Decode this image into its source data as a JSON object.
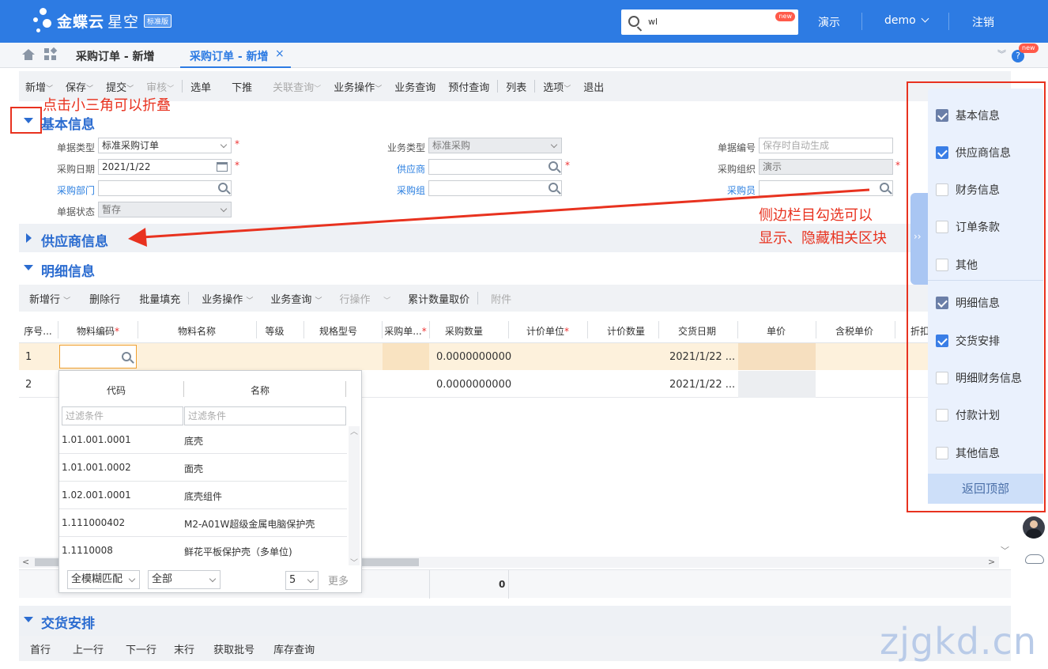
{
  "app": {
    "brand": "金蝶云",
    "brand2": "星空",
    "edition": "标准版"
  },
  "header": {
    "search_value": "wl",
    "search_badge": "new",
    "nav": [
      "演示",
      "demo",
      "注销"
    ]
  },
  "tabs": {
    "items": [
      "采购订单 - 新增",
      "采购订单 - 新增"
    ],
    "help_badge": "new"
  },
  "toolbar": {
    "items": [
      "新增",
      "保存",
      "提交",
      "审核",
      "选单",
      "下推",
      "关联查询",
      "业务操作",
      "业务查询",
      "预付查询",
      "列表",
      "选项",
      "退出"
    ]
  },
  "annotations": {
    "collapse_hint": "点击小三角可以折叠",
    "sidebar_hint_1": "侧边栏目勾选可以",
    "sidebar_hint_2": "显示、隐藏相关区块"
  },
  "basic_info": {
    "title": "基本信息",
    "fields": {
      "doc_type_label": "单据类型",
      "doc_type_value": "标准采购订单",
      "biz_type_label": "业务类型",
      "biz_type_value": "标准采购",
      "doc_no_label": "单据编号",
      "doc_no_placeholder": "保存时自动生成",
      "date_label": "采购日期",
      "date_value": "2021/1/22",
      "supplier_label": "供应商",
      "org_label": "采购组织",
      "org_value": "演示",
      "dept_label": "采购部门",
      "group_label": "采购组",
      "buyer_label": "采购员",
      "status_label": "单据状态",
      "status_value": "暂存"
    }
  },
  "supplier_section": {
    "title": "供应商信息"
  },
  "detail_section": {
    "title": "明细信息",
    "toolbar": [
      "新增行",
      "删除行",
      "批量填充",
      "业务操作",
      "业务查询",
      "行操作",
      "累计数量取价",
      "附件"
    ],
    "columns": [
      "序号...",
      "物料编码",
      "物料名称",
      "等级",
      "规格型号",
      "采购单...",
      "采购数量",
      "计价单位",
      "计价数量",
      "交货日期",
      "单价",
      "含税单价",
      "折扣"
    ],
    "rows": [
      {
        "no": "1",
        "qty": "0.0000000000",
        "date": "2021/1/22 ..."
      },
      {
        "no": "2",
        "qty": "0.0000000000",
        "date": "2021/1/22 ..."
      }
    ],
    "total": "0"
  },
  "lookup": {
    "col_code": "代码",
    "col_name": "名称",
    "filter_placeholder": "过滤条件",
    "items": [
      {
        "code": "1.01.001.0001",
        "name": "底壳"
      },
      {
        "code": "1.01.001.0002",
        "name": "面壳"
      },
      {
        "code": "1.02.001.0001",
        "name": "底壳组件"
      },
      {
        "code": "1.111000402",
        "name": "M2-A01W超级金属电脑保护壳"
      },
      {
        "code": "1.1110008",
        "name": "鲜花平板保护壳（多单位)"
      }
    ],
    "match_mode": "全模糊匹配",
    "scope": "全部",
    "page_size": "5",
    "more": "更多"
  },
  "delivery_section": {
    "title": "交货安排",
    "toolbar": [
      "首行",
      "上一行",
      "下一行",
      "末行",
      "获取批号",
      "库存查询"
    ]
  },
  "sidebar": {
    "items": [
      {
        "label": "基本信息",
        "checked": true,
        "style": "gray"
      },
      {
        "label": "供应商信息",
        "checked": true,
        "style": "blue"
      },
      {
        "label": "财务信息",
        "checked": false
      },
      {
        "label": "订单条款",
        "checked": false
      },
      {
        "label": "其他",
        "checked": false
      },
      {
        "label": "明细信息",
        "checked": true,
        "style": "gray"
      },
      {
        "label": "交货安排",
        "checked": true,
        "style": "blue"
      },
      {
        "label": "明细财务信息",
        "checked": false
      },
      {
        "label": "付款计划",
        "checked": false
      },
      {
        "label": "其他信息",
        "checked": false
      }
    ],
    "back_to_top": "返回顶部"
  },
  "watermark": "zjgkd.cn",
  "colors": {
    "primary": "#2d7be3",
    "annotation": "#e8321f",
    "section_title": "#2b6cd0"
  }
}
